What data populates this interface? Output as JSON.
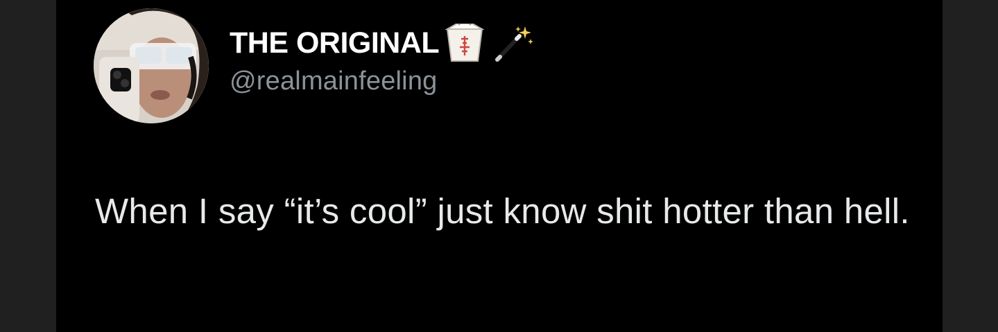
{
  "author": {
    "display_name": "THE ORIGINAL",
    "handle": "@realmainfeeling",
    "name_emojis": [
      "takeout-box-emoji",
      "magic-wand-emoji"
    ],
    "avatar": "profile-photo"
  },
  "tweet": {
    "text": "When I say “it’s cool” just know shit hotter than hell."
  },
  "colors": {
    "card_background": "#000000",
    "page_background": "#202020",
    "name_color": "#ffffff",
    "handle_color": "#8b9298",
    "text_color": "#e7e9ea"
  }
}
